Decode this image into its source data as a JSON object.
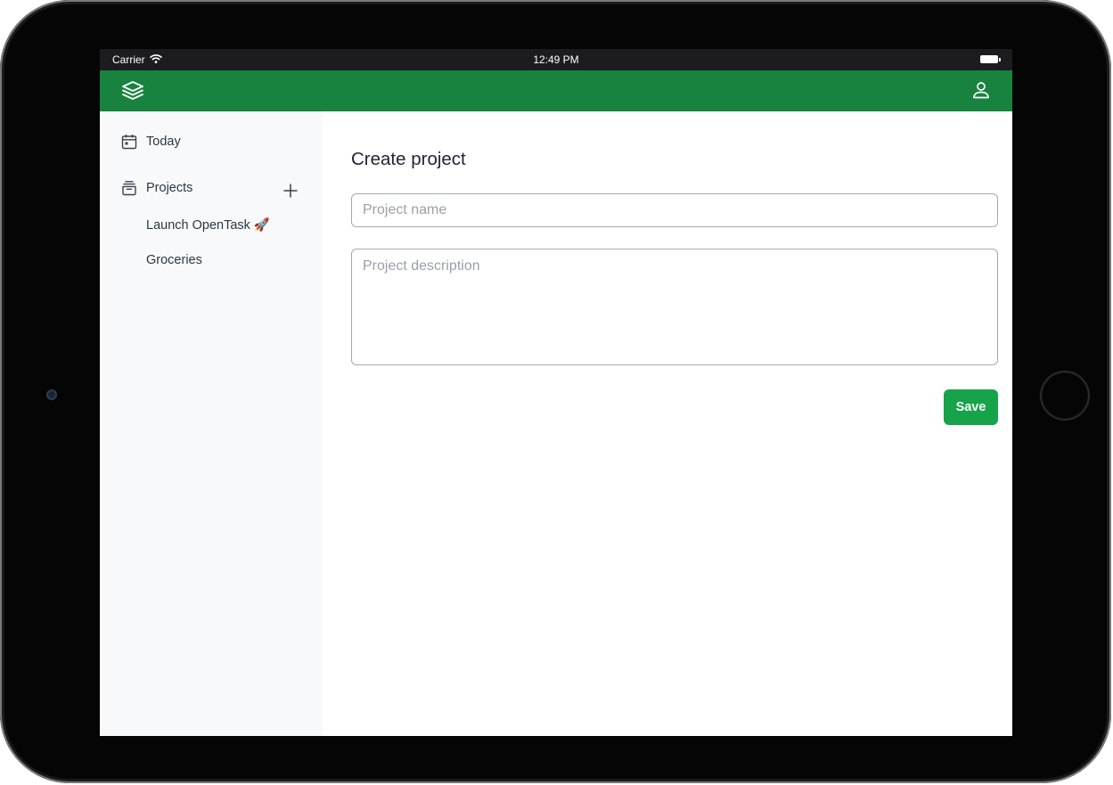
{
  "status_bar": {
    "carrier": "Carrier",
    "time": "12:49 PM",
    "wifi_icon": "wifi-icon",
    "battery_icon": "battery-icon"
  },
  "app_bar": {
    "logo_icon": "layers-logo-icon",
    "user_icon": "user-icon",
    "background_color": "#17833f"
  },
  "sidebar": {
    "today": {
      "label": "Today",
      "icon": "calendar-icon"
    },
    "projects": {
      "label": "Projects",
      "icon": "archive-icon",
      "add_icon": "plus-icon"
    },
    "project_items": [
      {
        "label": "Launch OpenTask 🚀"
      },
      {
        "label": "Groceries"
      }
    ]
  },
  "main": {
    "title": "Create project",
    "name_field": {
      "placeholder": "Project name",
      "value": ""
    },
    "description_field": {
      "placeholder": "Project description",
      "value": ""
    },
    "save_label": "Save",
    "save_color": "#16a34a"
  }
}
